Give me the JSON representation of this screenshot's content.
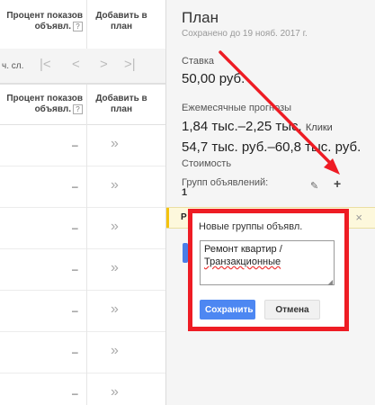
{
  "table": {
    "col_impressions": "Процент показов",
    "col_impressions_2": "объявл.",
    "col_add": "Добавить в",
    "col_add_2": "план",
    "help_icon": "question-icon",
    "qmark": "?"
  },
  "pager": {
    "label": "ч. сл.",
    "first": "|<",
    "prev": "<",
    "next": ">",
    "last": ">|"
  },
  "rows": [
    {
      "impressions": "–",
      "add": "»"
    },
    {
      "impressions": "–",
      "add": "»"
    },
    {
      "impressions": "–",
      "add": "»"
    },
    {
      "impressions": "–",
      "add": "»"
    },
    {
      "impressions": "–",
      "add": "»"
    },
    {
      "impressions": "–",
      "add": "»"
    },
    {
      "impressions": "–",
      "add": "»"
    },
    {
      "impressions": "–",
      "add": "»"
    }
  ],
  "plan": {
    "title": "План",
    "saved": "Сохранено до 19 нояб. 2017 г.",
    "bid_label": "Ставка",
    "bid_value": "50,00 руб.",
    "forecast_label": "Ежемесячные прогнозы",
    "clicks_value": "1,84 тыс.–2,25 тыс.",
    "clicks_unit": "Клики",
    "cost_value": "54,7 тыс. руб.–60,8 тыс. руб.",
    "cost_label": "Стоимость",
    "adgroups_label": "Групп объявлений:",
    "adgroups_count": "1",
    "edit_icon": "pencil-icon",
    "add_icon": "plus-icon"
  },
  "strip": {
    "label": "Р",
    "close": "×"
  },
  "popup": {
    "title": "Новые группы объявл.",
    "line1": "Ремонт квартир /",
    "line2": "Транзакционные",
    "save": "Сохранить",
    "cancel": "Отмена"
  },
  "colors": {
    "accent": "#4d87f2",
    "highlight": "#ee1c24",
    "strip": "#fdf8dc"
  }
}
